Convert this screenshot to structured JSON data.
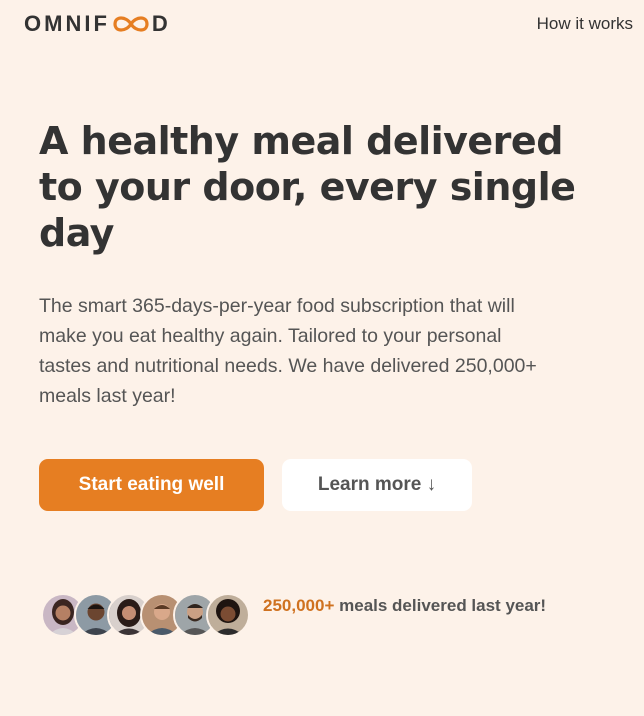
{
  "header": {
    "logo": {
      "prefix": "OMNIF",
      "suffix": "D"
    },
    "nav_link": "How it works"
  },
  "hero": {
    "title": "A healthy meal delivered to your door, every single day",
    "description": "The smart 365-days-per-year food subscription that will make you eat healthy again. Tailored to your personal tastes and nutritional needs. We have delivered 250,000+ meals last year!",
    "primary_button": "Start eating well",
    "secondary_button": "Learn more ↓"
  },
  "delivered": {
    "count": "250,000+",
    "text": "meals delivered last year!"
  },
  "colors": {
    "accent": "#e67e22",
    "background": "#fdf2e9",
    "text": "#333333",
    "highlight": "#cf711f"
  }
}
